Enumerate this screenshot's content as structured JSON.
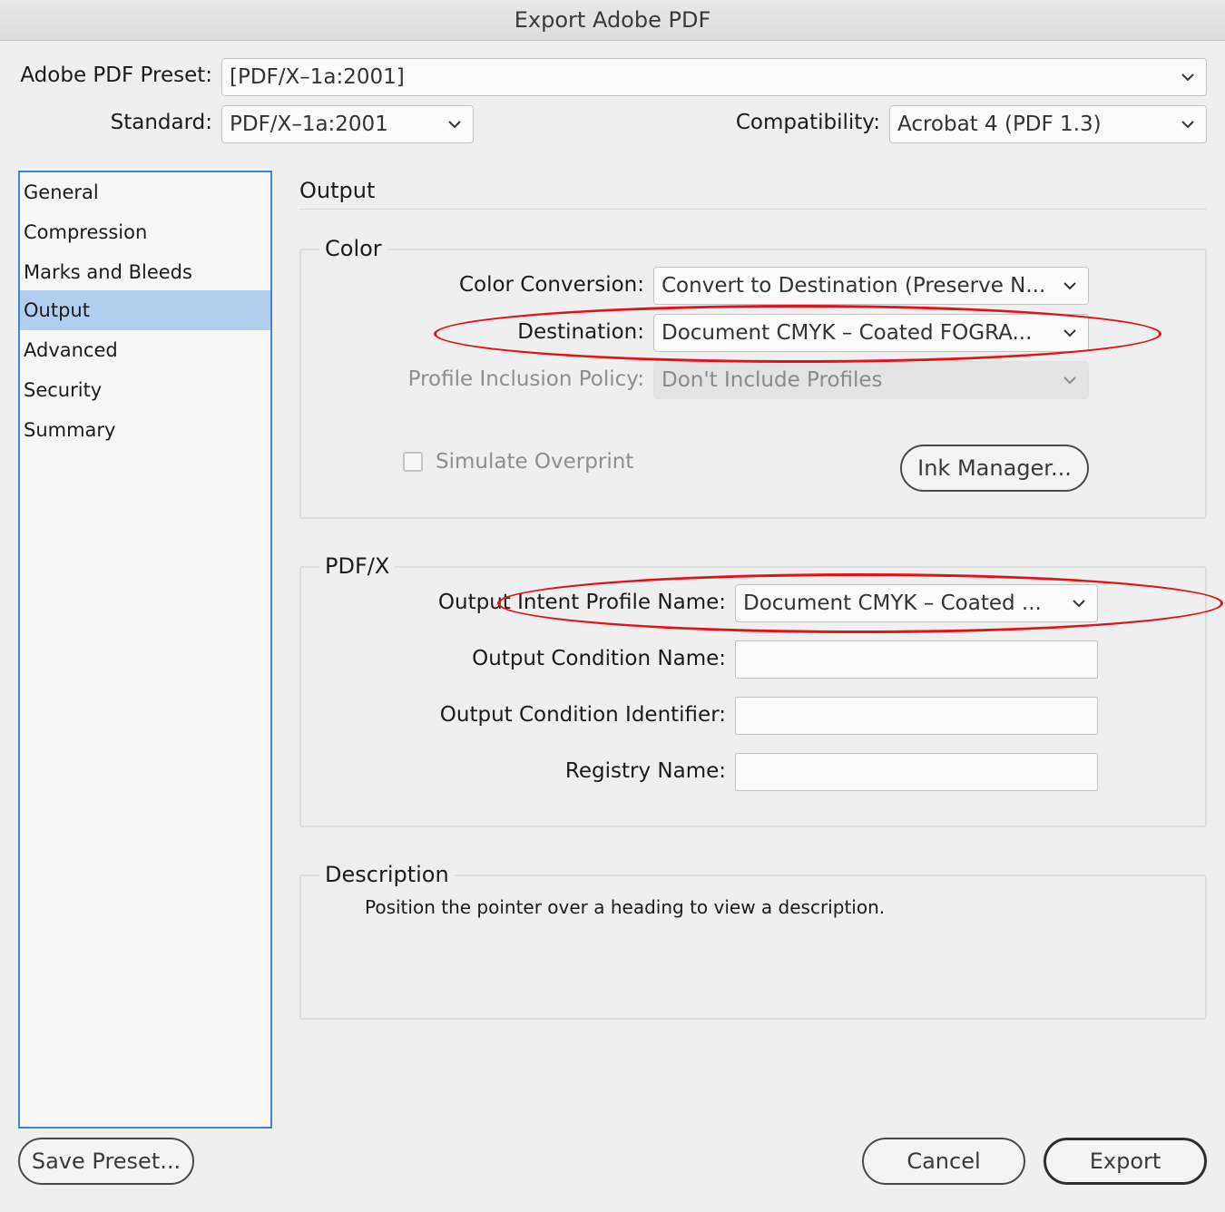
{
  "window": {
    "title": "Export Adobe PDF"
  },
  "preset": {
    "label": "Adobe PDF Preset:",
    "value": "[PDF/X–1a:2001]"
  },
  "standard": {
    "label": "Standard:",
    "value": "PDF/X–1a:2001"
  },
  "compatibility": {
    "label": "Compatibility:",
    "value": "Acrobat 4 (PDF 1.3)"
  },
  "sidebar": {
    "items": [
      {
        "label": "General"
      },
      {
        "label": "Compression"
      },
      {
        "label": "Marks and Bleeds"
      },
      {
        "label": "Output",
        "selected": true
      },
      {
        "label": "Advanced"
      },
      {
        "label": "Security"
      },
      {
        "label": "Summary"
      }
    ]
  },
  "page": {
    "title": "Output"
  },
  "color": {
    "legend": "Color",
    "conversion_label": "Color Conversion:",
    "conversion_value": "Convert to Destination (Preserve N...",
    "destination_label": "Destination:",
    "destination_value": "Document CMYK – Coated FOGRA...",
    "policy_label": "Profile Inclusion Policy:",
    "policy_value": "Don't Include Profiles",
    "simulate_label": "Simulate Overprint",
    "simulate_checked": false,
    "ink_manager_label": "Ink Manager..."
  },
  "pdfx": {
    "legend": "PDF/X",
    "intent_label": "Output Intent Profile Name:",
    "intent_value": "Document CMYK – Coated ...",
    "condition_name_label": "Output Condition Name:",
    "condition_name_value": "",
    "condition_id_label": "Output Condition Identifier:",
    "condition_id_value": "",
    "registry_label": "Registry Name:",
    "registry_value": ""
  },
  "description": {
    "legend": "Description",
    "text": "Position the pointer over a heading to view a description."
  },
  "buttons": {
    "save_preset": "Save Preset...",
    "cancel": "Cancel",
    "export": "Export"
  },
  "annotation": {
    "color": "#e0131a"
  }
}
